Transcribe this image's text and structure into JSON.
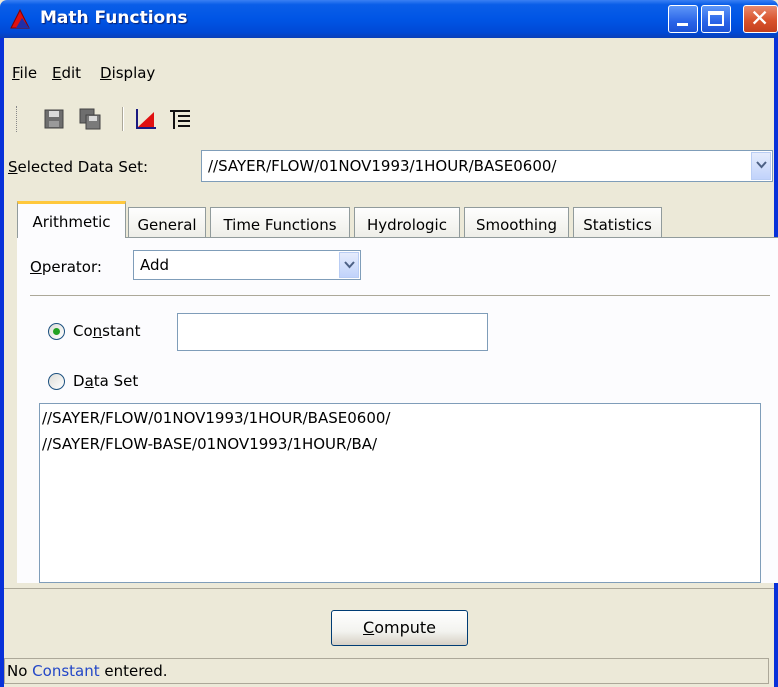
{
  "window": {
    "title": "Math Functions",
    "icon": "red-triangle-app-icon",
    "controls": [
      "minimize-icon",
      "maximize-icon",
      "close-icon"
    ]
  },
  "menu": {
    "file": {
      "mnemonic": "F",
      "rest": "ile"
    },
    "edit": {
      "mnemonic": "E",
      "rest": "dit"
    },
    "display": {
      "mnemonic": "D",
      "rest": "isplay"
    }
  },
  "toolbar": {
    "icons": [
      "save-icon",
      "save-all-icon",
      "plot-icon",
      "table-icon"
    ]
  },
  "selected_data_set": {
    "label_mnemonic": "S",
    "label_rest": "elected Data Set:",
    "value": "//SAYER/FLOW/01NOV1993/1HOUR/BASE0600/"
  },
  "tabs": [
    {
      "label": "Arithmetic",
      "active": true
    },
    {
      "label": "General",
      "active": false
    },
    {
      "label": "Time Functions",
      "active": false
    },
    {
      "label": "Hydrologic",
      "active": false
    },
    {
      "label": "Smoothing",
      "active": false
    },
    {
      "label": "Statistics",
      "active": false
    }
  ],
  "arithmetic": {
    "operator_label_mnemonic": "O",
    "operator_label_rest": "perator:",
    "operator_value": "Add",
    "constant_label_pre": "Co",
    "constant_label_mnemonic": "n",
    "constant_label_post": "stant",
    "constant_selected": true,
    "constant_value": "",
    "dataset_label_pre": "D",
    "dataset_label_mnemonic": "a",
    "dataset_label_post": "ta Set",
    "dataset_selected": false,
    "dataset_list": [
      "//SAYER/FLOW/01NOV1993/1HOUR/BASE0600/",
      "//SAYER/FLOW-BASE/01NOV1993/1HOUR/BA/"
    ]
  },
  "compute_button": {
    "mnemonic": "C",
    "rest": "ompute"
  },
  "status": {
    "pre": "No ",
    "highlight": "Constant",
    "post": " entered."
  },
  "colors": {
    "titlebar": "#0055E5",
    "frame": "#0831D9",
    "radio_dot": "#21A121",
    "tab_active_accent": "#FFC83C"
  }
}
